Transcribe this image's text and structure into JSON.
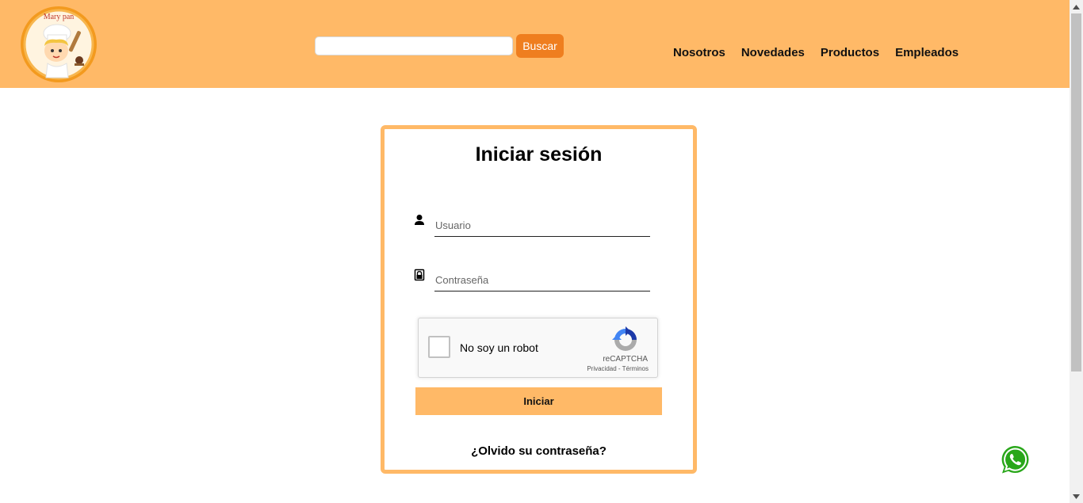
{
  "header": {
    "logo_text": "Mary pan",
    "search": {
      "placeholder": "",
      "value": "",
      "button_label": "Buscar"
    },
    "nav": [
      {
        "label": "Nosotros"
      },
      {
        "label": "Novedades"
      },
      {
        "label": "Productos"
      },
      {
        "label": "Empleados"
      }
    ]
  },
  "login": {
    "title": "Iniciar sesión",
    "username_placeholder": "Usuario",
    "password_placeholder": "Contraseña",
    "recaptcha": {
      "label": "No soy un robot",
      "brand": "reCAPTCHA",
      "privacy": "Privacidad",
      "separator": " - ",
      "terms": "Términos"
    },
    "submit_label": "Iniciar",
    "forgot_label": "¿Olvido su contraseña?"
  },
  "icons": {
    "user_field": "user-icon",
    "password_field": "lock-icon",
    "floating_contact": "whatsapp-icon"
  },
  "colors": {
    "header_bg": "#ffb967",
    "search_button_bg": "#ef7e1f",
    "card_border": "#ffb967",
    "submit_bg": "#ffb967",
    "whatsapp_green": "#29a71a"
  }
}
